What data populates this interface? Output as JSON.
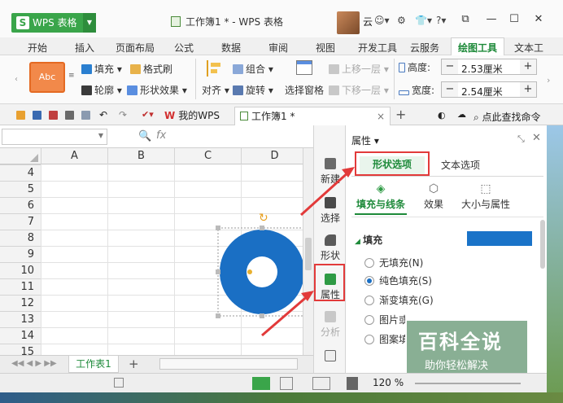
{
  "app": {
    "name": "WPS 表格",
    "logo": "S"
  },
  "title": "工作簿1 * - WPS 表格",
  "user": {
    "name": "云"
  },
  "menu_tabs": [
    "开始",
    "插入",
    "页面布局",
    "公式",
    "数据",
    "审阅",
    "视图",
    "开发工具",
    "云服务",
    "绘图工具",
    "文本工"
  ],
  "ribbon": {
    "shape_preview": "Abc",
    "fill": "填充",
    "format_painter": "格式刷",
    "outline": "轮廓",
    "shape_effects": "形状效果",
    "align": "对齐",
    "group": "组合",
    "rotate": "旋转",
    "selection_pane": "选择窗格",
    "bring_forward": "上移一层",
    "send_backward": "下移一层",
    "height_label": "高度:",
    "height_value": "2.53厘米",
    "width_label": "宽度:",
    "width_value": "2.54厘米",
    "minus": "−",
    "plus": "+"
  },
  "doc_tabs": {
    "mywps": "我的WPS",
    "workbook": "工作簿1 *",
    "close": "×",
    "add": "+",
    "search": "点此查找命令"
  },
  "formula": {
    "fx": "fx"
  },
  "sheet": {
    "columns": [
      "A",
      "B",
      "C",
      "D"
    ],
    "rows": [
      "4",
      "5",
      "6",
      "7",
      "8",
      "9",
      "10",
      "11",
      "12",
      "13",
      "14",
      "15"
    ],
    "tab_name": "工作表1",
    "add": "+"
  },
  "side_toolbar": [
    "新建",
    "选择",
    "形状",
    "属性",
    "分析"
  ],
  "panel": {
    "title": "属性",
    "tab_shape": "形状选项",
    "tab_text": "文本选项",
    "sub_fill": "填充与线条",
    "sub_effects": "效果",
    "sub_size": "大小与属性",
    "section": "填充",
    "fill_color": "#1a73c8",
    "options": [
      "无填充(N)",
      "纯色填充(S)",
      "渐变填充(G)",
      "图片或纹理填充(P)",
      "图案填充(A)"
    ],
    "selected": 1
  },
  "status": {
    "zoom": "120 %"
  },
  "watermark": {
    "title": "百科全说",
    "subtitle": "助你轻松解决"
  },
  "colors": {
    "accent": "#1e8a3a",
    "annotation": "#e23a3a",
    "shape": "#1a6fc4"
  }
}
